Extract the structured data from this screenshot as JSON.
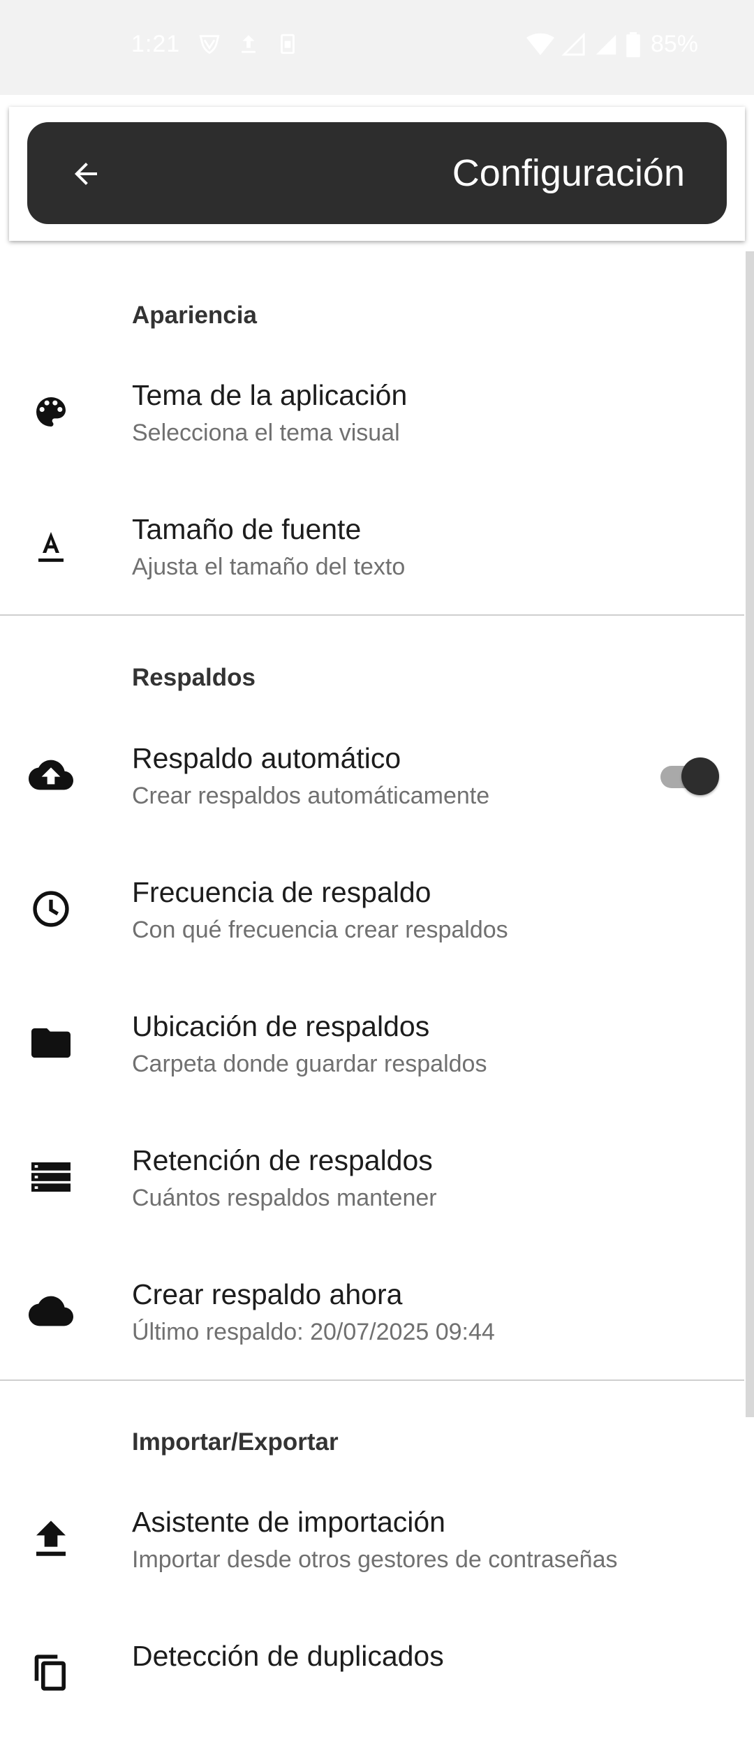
{
  "status_bar": {
    "time": "1:21",
    "battery": "85%"
  },
  "app_bar": {
    "title": "Configuración"
  },
  "sections": {
    "appearance": {
      "header": "Apariencia",
      "items": [
        {
          "title": "Tema de la aplicación",
          "summary": "Selecciona el tema visual",
          "icon": "palette-icon"
        },
        {
          "title": "Tamaño de fuente",
          "summary": "Ajusta el tamaño del texto",
          "icon": "text-format-icon"
        }
      ]
    },
    "backups": {
      "header": "Respaldos",
      "items": [
        {
          "title": "Respaldo automático",
          "summary": "Crear respaldos automáticamente",
          "icon": "cloud-upload-icon",
          "switch_on": true
        },
        {
          "title": "Frecuencia de respaldo",
          "summary": "Con qué frecuencia crear respaldos",
          "icon": "clock-icon"
        },
        {
          "title": "Ubicación de respaldos",
          "summary": "Carpeta donde guardar respaldos",
          "icon": "folder-icon"
        },
        {
          "title": "Retención de respaldos",
          "summary": "Cuántos respaldos mantener",
          "icon": "storage-list-icon"
        },
        {
          "title": "Crear respaldo ahora",
          "summary": "Último respaldo: 20/07/2025 09:44",
          "icon": "cloud-icon"
        }
      ]
    },
    "import_export": {
      "header": "Importar/Exportar",
      "items": [
        {
          "title": "Asistente de importación",
          "summary": "Importar desde otros gestores de contraseñas",
          "icon": "upload-icon"
        },
        {
          "title": "Detección de duplicados",
          "summary": "",
          "icon": "copy-icon"
        }
      ]
    }
  }
}
